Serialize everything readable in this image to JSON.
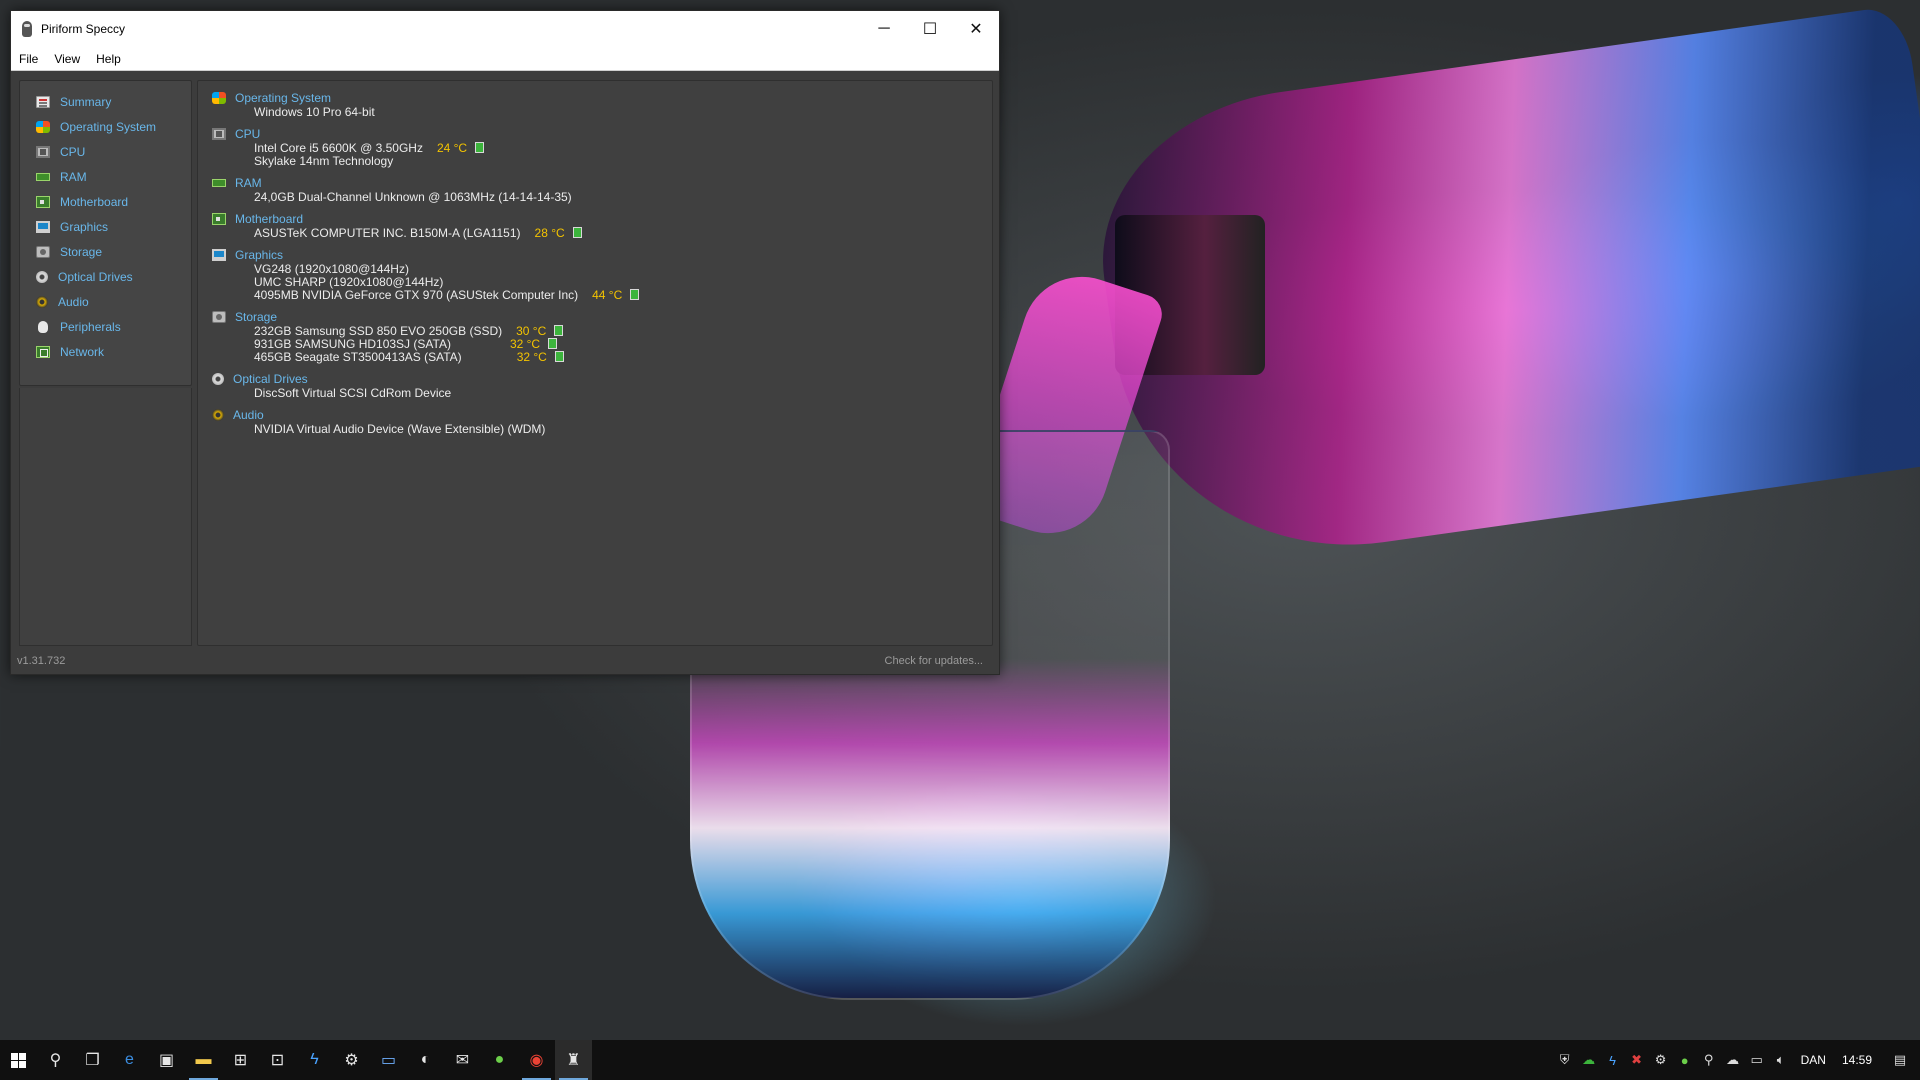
{
  "window": {
    "title": "Piriform Speccy",
    "controls": {
      "minimize": "─",
      "maximize": "☐",
      "close": "✕"
    },
    "menu": [
      "File",
      "View",
      "Help"
    ]
  },
  "sidebar": {
    "items": [
      {
        "label": "Summary",
        "icon": "summary-icon"
      },
      {
        "label": "Operating System",
        "icon": "os-icon"
      },
      {
        "label": "CPU",
        "icon": "cpu-icon"
      },
      {
        "label": "RAM",
        "icon": "ram-icon"
      },
      {
        "label": "Motherboard",
        "icon": "motherboard-icon"
      },
      {
        "label": "Graphics",
        "icon": "graphics-icon"
      },
      {
        "label": "Storage",
        "icon": "storage-icon"
      },
      {
        "label": "Optical Drives",
        "icon": "optical-drive-icon"
      },
      {
        "label": "Audio",
        "icon": "audio-icon"
      },
      {
        "label": "Peripherals",
        "icon": "peripherals-icon"
      },
      {
        "label": "Network",
        "icon": "network-icon"
      }
    ]
  },
  "summary": {
    "os": {
      "title": "Operating System",
      "lines": [
        "Windows 10 Pro 64-bit"
      ]
    },
    "cpu": {
      "title": "CPU",
      "lines": [
        "Intel Core i5 6600K @ 3.50GHz",
        "Skylake 14nm Technology"
      ],
      "temp": "24 °C"
    },
    "ram": {
      "title": "RAM",
      "lines": [
        "24,0GB Dual-Channel Unknown @ 1063MHz (14-14-14-35)"
      ]
    },
    "motherboard": {
      "title": "Motherboard",
      "lines": [
        "ASUSTeK COMPUTER INC. B150M-A (LGA1151)"
      ],
      "temp": "28 °C"
    },
    "graphics": {
      "title": "Graphics",
      "lines": [
        "VG248 (1920x1080@144Hz)",
        "UMC SHARP (1920x1080@144Hz)",
        "4095MB NVIDIA GeForce GTX 970 (ASUStek Computer Inc)"
      ],
      "temp": "44 °C"
    },
    "storage": {
      "title": "Storage",
      "drives": [
        {
          "name": "232GB Samsung SSD 850 EVO 250GB (SSD)",
          "temp": "30 °C"
        },
        {
          "name": "931GB SAMSUNG HD103SJ (SATA)",
          "temp": "32 °C"
        },
        {
          "name": "465GB Seagate ST3500413AS (SATA)",
          "temp": "32 °C"
        }
      ]
    },
    "optical": {
      "title": "Optical Drives",
      "lines": [
        "DiscSoft Virtual SCSI CdRom Device"
      ]
    },
    "audio": {
      "title": "Audio",
      "lines": [
        "NVIDIA Virtual Audio Device (Wave Extensible) (WDM)"
      ]
    }
  },
  "status": {
    "version": "v1.31.732",
    "check_updates": "Check for updates..."
  },
  "taskbar": {
    "tray": {
      "language": "DAN",
      "time": "14:59"
    }
  },
  "colors": {
    "accent": "#69b7ea",
    "temp": "#f3c300",
    "temp_ok": "#3cb43c",
    "background": "#3c3c3c"
  }
}
